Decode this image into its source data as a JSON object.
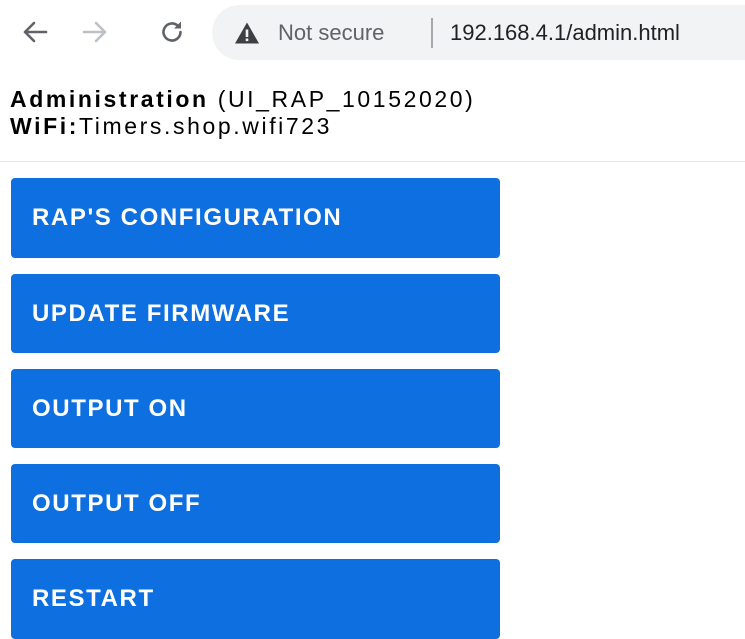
{
  "browser": {
    "back_icon": "arrow-left-icon",
    "forward_icon": "arrow-right-icon",
    "reload_icon": "reload-icon",
    "security_icon": "warning-triangle-icon",
    "security_label": "Not secure",
    "url": "192.168.4.1/admin.html"
  },
  "header": {
    "title": "Administration",
    "version": "(UI_RAP_10152020)",
    "wifi_label": "WiFi:",
    "wifi_value": "Timers.shop.wifi723"
  },
  "buttons": [
    {
      "label": "RAP'S CONFIGURATION"
    },
    {
      "label": "UPDATE FIRMWARE"
    },
    {
      "label": "OUTPUT ON"
    },
    {
      "label": "OUTPUT OFF"
    },
    {
      "label": "RESTART"
    }
  ],
  "colors": {
    "button_bg": "#0d6fe0",
    "button_text": "#ffffff",
    "omnibox_bg": "#f1f3f4"
  }
}
